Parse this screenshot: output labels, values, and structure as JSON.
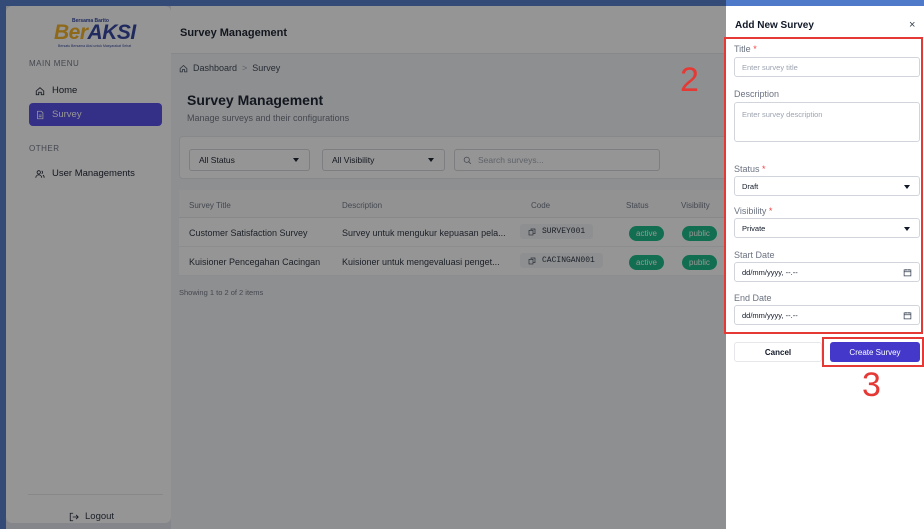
{
  "sidebar": {
    "logo": {
      "brand_ber": "Ber",
      "brand_aksi": "AKSI",
      "small_text": "Bersama Barito",
      "tagline": "Bersatu Bersama Aksi untuk Masyarakat Sehat"
    },
    "main_menu_label": "MAIN MENU",
    "other_label": "OTHER",
    "items": [
      {
        "label": "Home",
        "icon": "home-icon",
        "active": false
      },
      {
        "label": "Survey",
        "icon": "file-icon",
        "active": true
      },
      {
        "label": "User Managements",
        "icon": "users-icon",
        "active": false
      }
    ],
    "logout_label": "Logout"
  },
  "header": {
    "title": "Survey Management"
  },
  "breadcrumb": {
    "home": "Dashboard",
    "separator": ">",
    "current": "Survey"
  },
  "page": {
    "title": "Survey Management",
    "subtitle": "Manage surveys and their configurations"
  },
  "filters": {
    "status": "All Status",
    "visibility": "All Visibility",
    "search_placeholder": "Search surveys..."
  },
  "table": {
    "headers": [
      "Survey Title",
      "Description",
      "Code",
      "Status",
      "Visibility"
    ],
    "rows": [
      {
        "title": "Customer Satisfaction Survey",
        "description": "Survey untuk mengukur kepuasan pela...",
        "code": "SURVEY001",
        "status": "active",
        "visibility": "public"
      },
      {
        "title": "Kuisioner Pencegahan Cacingan",
        "description": "Kuisioner untuk mengevaluasi penget...",
        "code": "CACINGAN001",
        "status": "active",
        "visibility": "public"
      }
    ],
    "footer": "Showing 1 to 2 of 2 items"
  },
  "drawer": {
    "title": "Add New Survey",
    "close": "×",
    "fields": {
      "title_label": "Title",
      "title_placeholder": "Enter survey title",
      "description_label": "Description",
      "description_placeholder": "Enter survey description",
      "status_label": "Status",
      "status_value": "Draft",
      "visibility_label": "Visibility",
      "visibility_value": "Private",
      "start_date_label": "Start Date",
      "start_date_value": "dd/mm/yyyy, --.--",
      "end_date_label": "End Date",
      "end_date_value": "dd/mm/yyyy, --.--",
      "required_mark": "*"
    },
    "cancel_label": "Cancel",
    "create_label": "Create Survey"
  },
  "annotations": {
    "form_number": "2",
    "button_number": "3",
    "color": "#e53935"
  },
  "colors": {
    "primary": "#4f46e5",
    "success": "#10b981",
    "danger": "#ef4444"
  }
}
